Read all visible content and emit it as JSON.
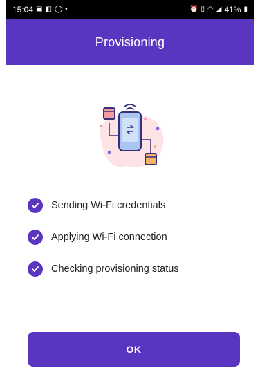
{
  "status_bar": {
    "time": "15:04",
    "battery": "41%",
    "left_icons": [
      "image-icon",
      "teams-icon",
      "whatsapp-icon",
      "dot-icon"
    ],
    "right_icons": [
      "alarm-icon",
      "vibrate-icon",
      "wifi-icon",
      "signal-icon",
      "battery-icon"
    ]
  },
  "app_bar": {
    "title": "Provisioning"
  },
  "illustration": {
    "icon": "device-provisioning-illustration"
  },
  "steps": [
    {
      "label": "Sending Wi-Fi credentials",
      "status": "done"
    },
    {
      "label": "Applying Wi-Fi connection",
      "status": "done"
    },
    {
      "label": "Checking provisioning status",
      "status": "done"
    }
  ],
  "ok_button": {
    "label": "OK"
  },
  "colors": {
    "accent": "#5a35c0",
    "illustration_accent": "#e57373",
    "text": "#222222"
  }
}
